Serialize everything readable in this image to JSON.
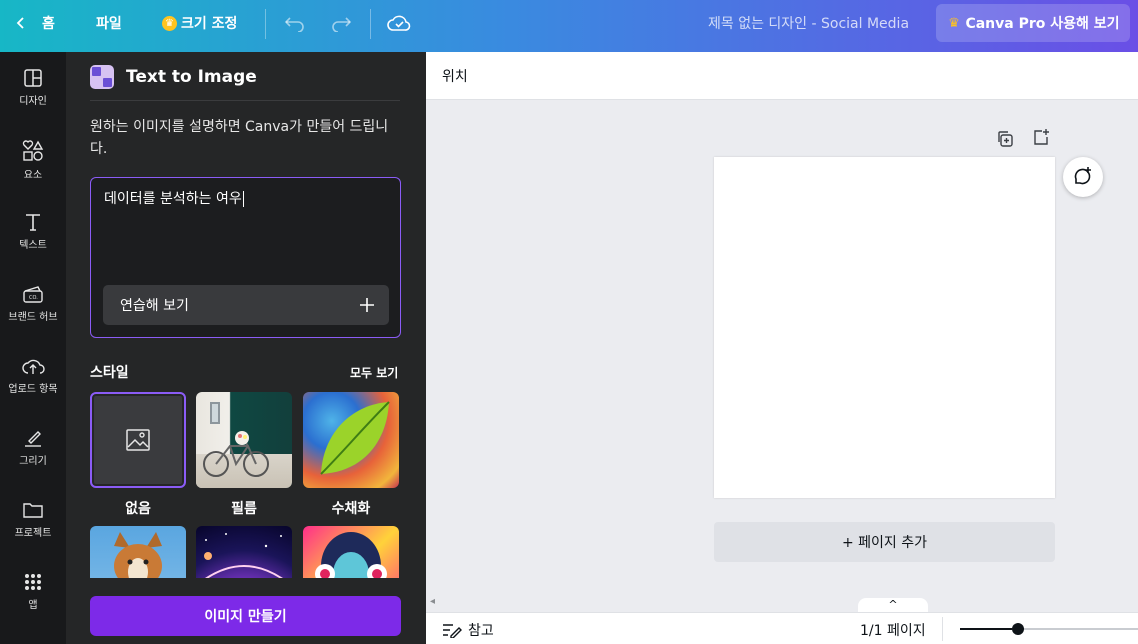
{
  "topbar": {
    "home_label": "홈",
    "file_label": "파일",
    "resize_label": "크기 조정",
    "doc_title": "제목 없는 디자인 - Social Media",
    "pro_label": "Canva Pro 사용해 보기"
  },
  "rail": {
    "items": [
      {
        "label": "디자인",
        "icon": "design-icon"
      },
      {
        "label": "요소",
        "icon": "elements-icon"
      },
      {
        "label": "텍스트",
        "icon": "text-icon"
      },
      {
        "label": "브랜드 허브",
        "icon": "brand-hub-icon"
      },
      {
        "label": "업로드 항목",
        "icon": "upload-icon"
      },
      {
        "label": "그리기",
        "icon": "draw-icon"
      },
      {
        "label": "프로젝트",
        "icon": "folder-icon"
      },
      {
        "label": "앱",
        "icon": "apps-icon"
      }
    ]
  },
  "panel": {
    "title": "Text to Image",
    "description": "원하는 이미지를 설명하면 Canva가 만들어 드립니다.",
    "prompt_value": "데이터를 분석하는 여우",
    "practice_label": "연습해 보기",
    "style_label": "스타일",
    "see_all_label": "모두 보기",
    "styles": [
      {
        "label": "없음"
      },
      {
        "label": "필름"
      },
      {
        "label": "수채화"
      },
      {
        "label": ""
      },
      {
        "label": ""
      },
      {
        "label": ""
      }
    ],
    "create_label": "이미지 만들기"
  },
  "editor": {
    "position_label": "위치",
    "add_page_label": "+ 페이지 추가"
  },
  "bottombar": {
    "notes_label": "참고",
    "page_count": "1/1 페이지"
  },
  "colors": {
    "accent": "#7d2ae8",
    "panel_bg": "#252627",
    "rail_bg": "#18191b"
  }
}
